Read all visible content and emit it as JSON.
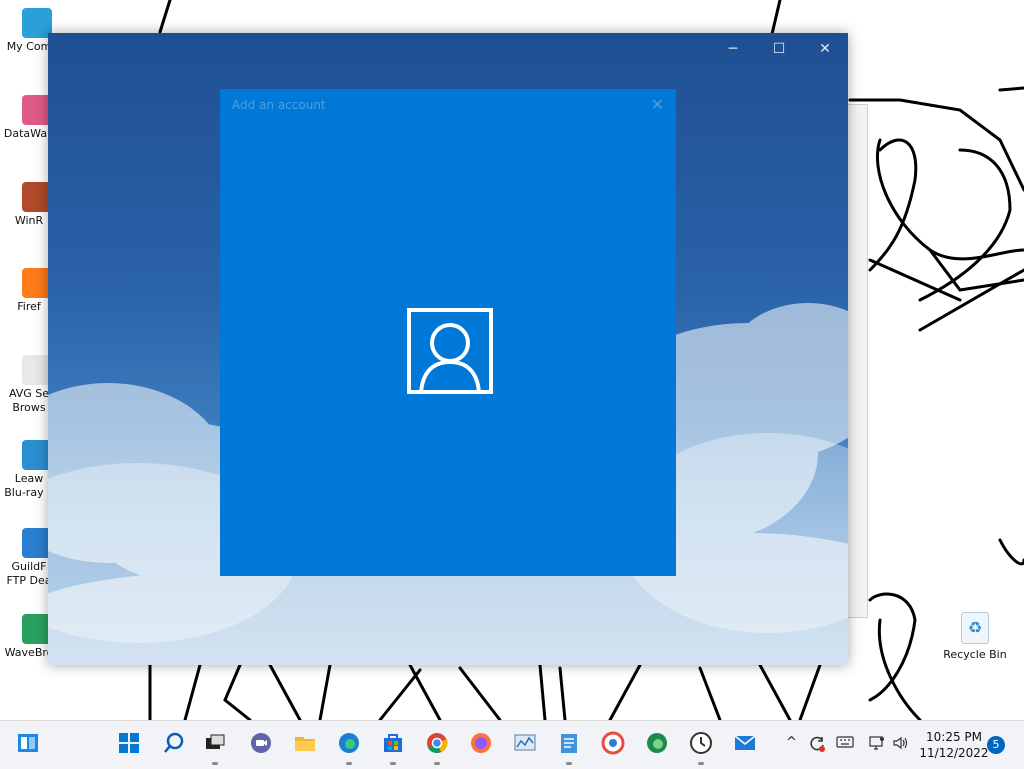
{
  "desktop": {
    "icons": [
      {
        "label": "My Com",
        "icon": "computer-icon",
        "color": "#2a9fd8"
      },
      {
        "label": "DataWap",
        "icon": "datawap-icon",
        "color": "#e05a8a"
      },
      {
        "label": "WinR",
        "icon": "winrar-icon",
        "color": "#b04a2a"
      },
      {
        "label": "Firef",
        "icon": "firefox-icon",
        "color": "#ff7a1a"
      },
      {
        "label": "AVG Se\nBrows",
        "icon": "avg-browser-icon",
        "color": "#e8e8e8"
      },
      {
        "label": "Leaw\nBlu-ray P",
        "icon": "leawo-icon",
        "color": "#2a8fd0"
      },
      {
        "label": "GuildF\nFTP Dea",
        "icon": "guildftp-icon",
        "color": "#2a7fd0"
      },
      {
        "label": "WaveBro",
        "icon": "wavebrowser-icon",
        "color": "#2aa060"
      }
    ],
    "recycle_bin": {
      "label": "Recycle Bin",
      "icon": "recycle-bin-icon"
    }
  },
  "window": {
    "controls": {
      "minimize": "─",
      "maximize": "☐",
      "close": "✕"
    }
  },
  "dialog": {
    "title": "Add an account",
    "close": "✕",
    "icon": "person-icon",
    "accent": "#0078d7"
  },
  "taskbar": {
    "apps": [
      {
        "name": "widgets",
        "icon": "widgets-icon"
      },
      {
        "name": "start",
        "icon": "windows-start-icon"
      },
      {
        "name": "search",
        "icon": "search-icon"
      },
      {
        "name": "task-view",
        "icon": "task-view-icon"
      },
      {
        "name": "teams",
        "icon": "teams-chat-icon"
      },
      {
        "name": "file-explorer",
        "icon": "folder-icon"
      },
      {
        "name": "edge",
        "icon": "edge-icon"
      },
      {
        "name": "store",
        "icon": "store-icon"
      },
      {
        "name": "chrome",
        "icon": "chrome-icon"
      },
      {
        "name": "firefox",
        "icon": "firefox-icon"
      },
      {
        "name": "resource-monitor",
        "icon": "monitor-chart-icon"
      },
      {
        "name": "notepad",
        "icon": "notepad-icon"
      },
      {
        "name": "avg-browser",
        "icon": "avg-browser-icon"
      },
      {
        "name": "edge-beta",
        "icon": "edge-beta-icon"
      },
      {
        "name": "clock-app",
        "icon": "clock-icon"
      },
      {
        "name": "mail",
        "icon": "mail-icon"
      }
    ],
    "tray": {
      "chevron": "^",
      "time": "10:25 PM",
      "date": "11/12/2022",
      "notification_count": "5"
    }
  }
}
